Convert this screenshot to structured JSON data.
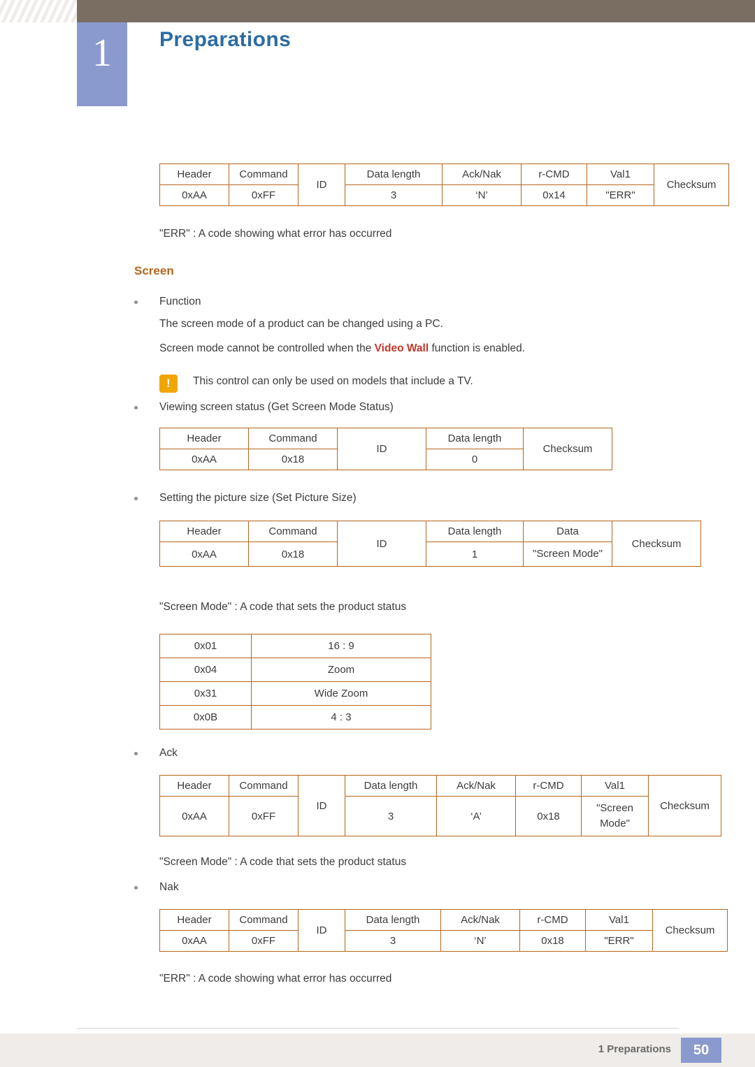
{
  "header": {
    "chapter_number": "1",
    "title": "Preparations"
  },
  "footer": {
    "label": "1 Preparations",
    "page": "50"
  },
  "body": {
    "err_note_top": "\"ERR\" : A code showing what error has occurred",
    "screen_heading": "Screen",
    "function_label": "Function",
    "function_line1": "The screen mode of a product can be changed using a PC.",
    "function_line2_pre": "Screen mode cannot be controlled when the ",
    "function_line2_accent": "Video Wall",
    "function_line2_post": " function is enabled.",
    "note_icon": "!",
    "note_text": "This control can only be used on models that include a TV.",
    "viewing_label": "Viewing screen status (Get Screen Mode Status)",
    "setting_label": "Setting the picture size (Set Picture Size)",
    "screen_mode_note_1": "\"Screen Mode\" : A code that sets the product status",
    "ack_label": "Ack",
    "screen_mode_note_2": "\"Screen Mode\" : A code that sets the product status",
    "nak_label": "Nak",
    "err_note_bottom": "\"ERR\" : A code showing what error has occurred"
  },
  "tables": {
    "nak_top": {
      "headers": [
        "Header",
        "Command",
        "ID",
        "Data length",
        "Ack/Nak",
        "r-CMD",
        "Val1",
        "Checksum"
      ],
      "values": [
        "0xAA",
        "0xFF",
        "",
        "3",
        "‘N’",
        "0x14",
        "\"ERR\"",
        ""
      ]
    },
    "get_screen": {
      "headers": [
        "Header",
        "Command",
        "ID",
        "Data length",
        "Checksum"
      ],
      "values": [
        "0xAA",
        "0x18",
        "",
        "0",
        ""
      ]
    },
    "set_picture": {
      "headers": [
        "Header",
        "Command",
        "ID",
        "Data length",
        "Data",
        "Checksum"
      ],
      "values": [
        "0xAA",
        "0x18",
        "",
        "1",
        "\"Screen Mode\"",
        ""
      ]
    },
    "screen_mode_codes": {
      "rows": [
        [
          "0x01",
          "16 : 9"
        ],
        [
          "0x04",
          "Zoom"
        ],
        [
          "0x31",
          "Wide Zoom"
        ],
        [
          "0x0B",
          "4 : 3"
        ]
      ]
    },
    "ack": {
      "headers": [
        "Header",
        "Command",
        "ID",
        "Data length",
        "Ack/Nak",
        "r-CMD",
        "Val1",
        "Checksum"
      ],
      "values": [
        "0xAA",
        "0xFF",
        "",
        "3",
        "‘A’",
        "0x18",
        "\"Screen Mode\"",
        ""
      ]
    },
    "nak_bottom": {
      "headers": [
        "Header",
        "Command",
        "ID",
        "Data length",
        "Ack/Nak",
        "r-CMD",
        "Val1",
        "Checksum"
      ],
      "values": [
        "0xAA",
        "0xFF",
        "",
        "3",
        "‘N’",
        "0x18",
        "\"ERR\"",
        ""
      ]
    }
  }
}
